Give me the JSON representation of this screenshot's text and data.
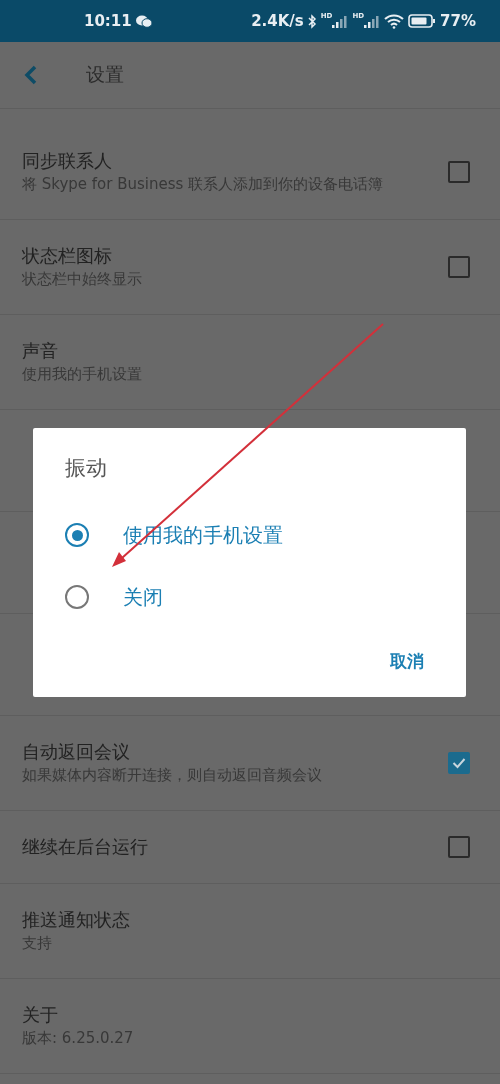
{
  "status_bar": {
    "time": "10:11",
    "speed": "2.4K/s",
    "sim_labels": [
      "HD",
      "HD"
    ],
    "battery": "77%"
  },
  "header": {
    "title": "设置"
  },
  "settings": [
    {
      "title": "同步联系人",
      "subtitle": "将 Skype for Business 联系人添加到你的设备电话簿",
      "kind": "checkbox",
      "checked": false
    },
    {
      "title": "状态栏图标",
      "subtitle": "状态栏中始终显示",
      "kind": "checkbox",
      "checked": false
    },
    {
      "title": "声音",
      "subtitle": "使用我的手机设置",
      "kind": "plain"
    },
    {
      "kind": "covered"
    },
    {
      "kind": "covered"
    },
    {
      "kind": "covered"
    },
    {
      "title": "自动返回会议",
      "subtitle": "如果媒体内容断开连接，则自动返回音频会议",
      "kind": "checkbox",
      "checked": true
    },
    {
      "title": "继续在后台运行",
      "kind": "checkbox",
      "checked": false
    },
    {
      "title": "推送通知状态",
      "subtitle": "支持",
      "kind": "plain"
    },
    {
      "title": "关于",
      "subtitle": "版本: 6.25.0.27",
      "kind": "plain"
    }
  ],
  "dialog": {
    "title": "振动",
    "options": [
      {
        "label": "使用我的手机设置",
        "selected": true
      },
      {
        "label": "关闭",
        "selected": false
      }
    ],
    "button": "取消"
  }
}
